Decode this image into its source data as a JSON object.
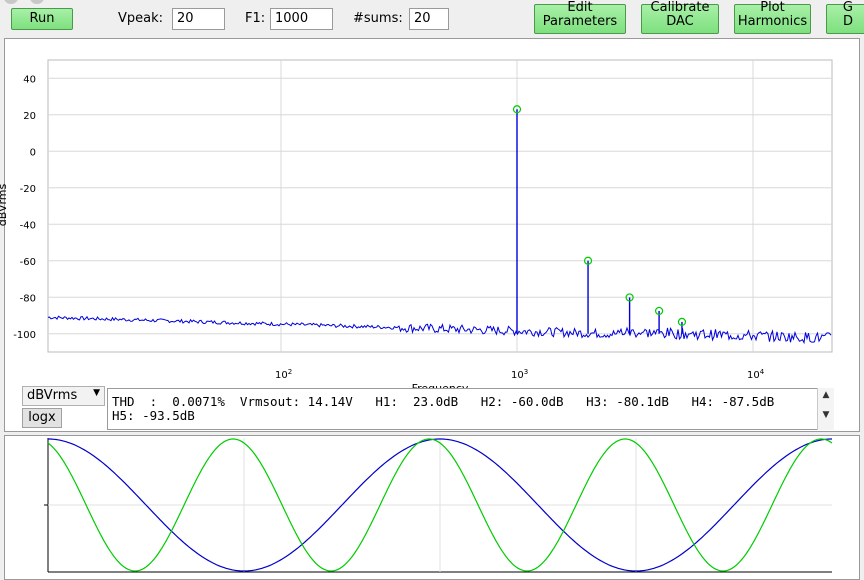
{
  "toolbar": {
    "run_label": "Run",
    "vpeak_label": "Vpeak:",
    "vpeak_value": "20",
    "f1_label": "F1:",
    "f1_value": "1000",
    "sums_label": "#sums:",
    "sums_value": "20",
    "edit_params_line1": "Edit",
    "edit_params_line2": "Parameters",
    "calibrate_line1": "Calibrate",
    "calibrate_line2": "DAC",
    "plot_harm_line1": "Plot",
    "plot_harm_line2": "Harmonics",
    "cut_btn_line1": "G",
    "cut_btn_line2": "D"
  },
  "spectrum": {
    "ylabel": "dBVrms",
    "xlabel": "Frequency",
    "y_ticks": [
      "40",
      "20",
      "0",
      "-20",
      "-40",
      "-60",
      "-80",
      "-100"
    ],
    "x_ticks": [
      {
        "base": "10",
        "exp": "2"
      },
      {
        "base": "10",
        "exp": "3"
      },
      {
        "base": "10",
        "exp": "4"
      }
    ],
    "harmonic_markers": [
      {
        "f": 1000,
        "db": 23.0
      },
      {
        "f": 2000,
        "db": -60.0
      },
      {
        "f": 3000,
        "db": -80.1
      },
      {
        "f": 4000,
        "db": -87.5
      },
      {
        "f": 5000,
        "db": -93.5
      }
    ],
    "colors": {
      "trace": "#0000dd",
      "marker": "#00cc00",
      "grid": "#d8d8d8"
    }
  },
  "controls": {
    "units_value": "dBVrms",
    "logx_label": "logx"
  },
  "results": {
    "line1": "THD  :  0.0071%  Vrmsout: 14.14V   H1:  23.0dB   H2: -60.0dB   H3: -80.1dB   H4: -87.5dB",
    "line2": "H5: -93.5dB"
  },
  "waveform": {
    "colors": {
      "out": "#0000cc",
      "in": "#00cc00"
    }
  }
}
